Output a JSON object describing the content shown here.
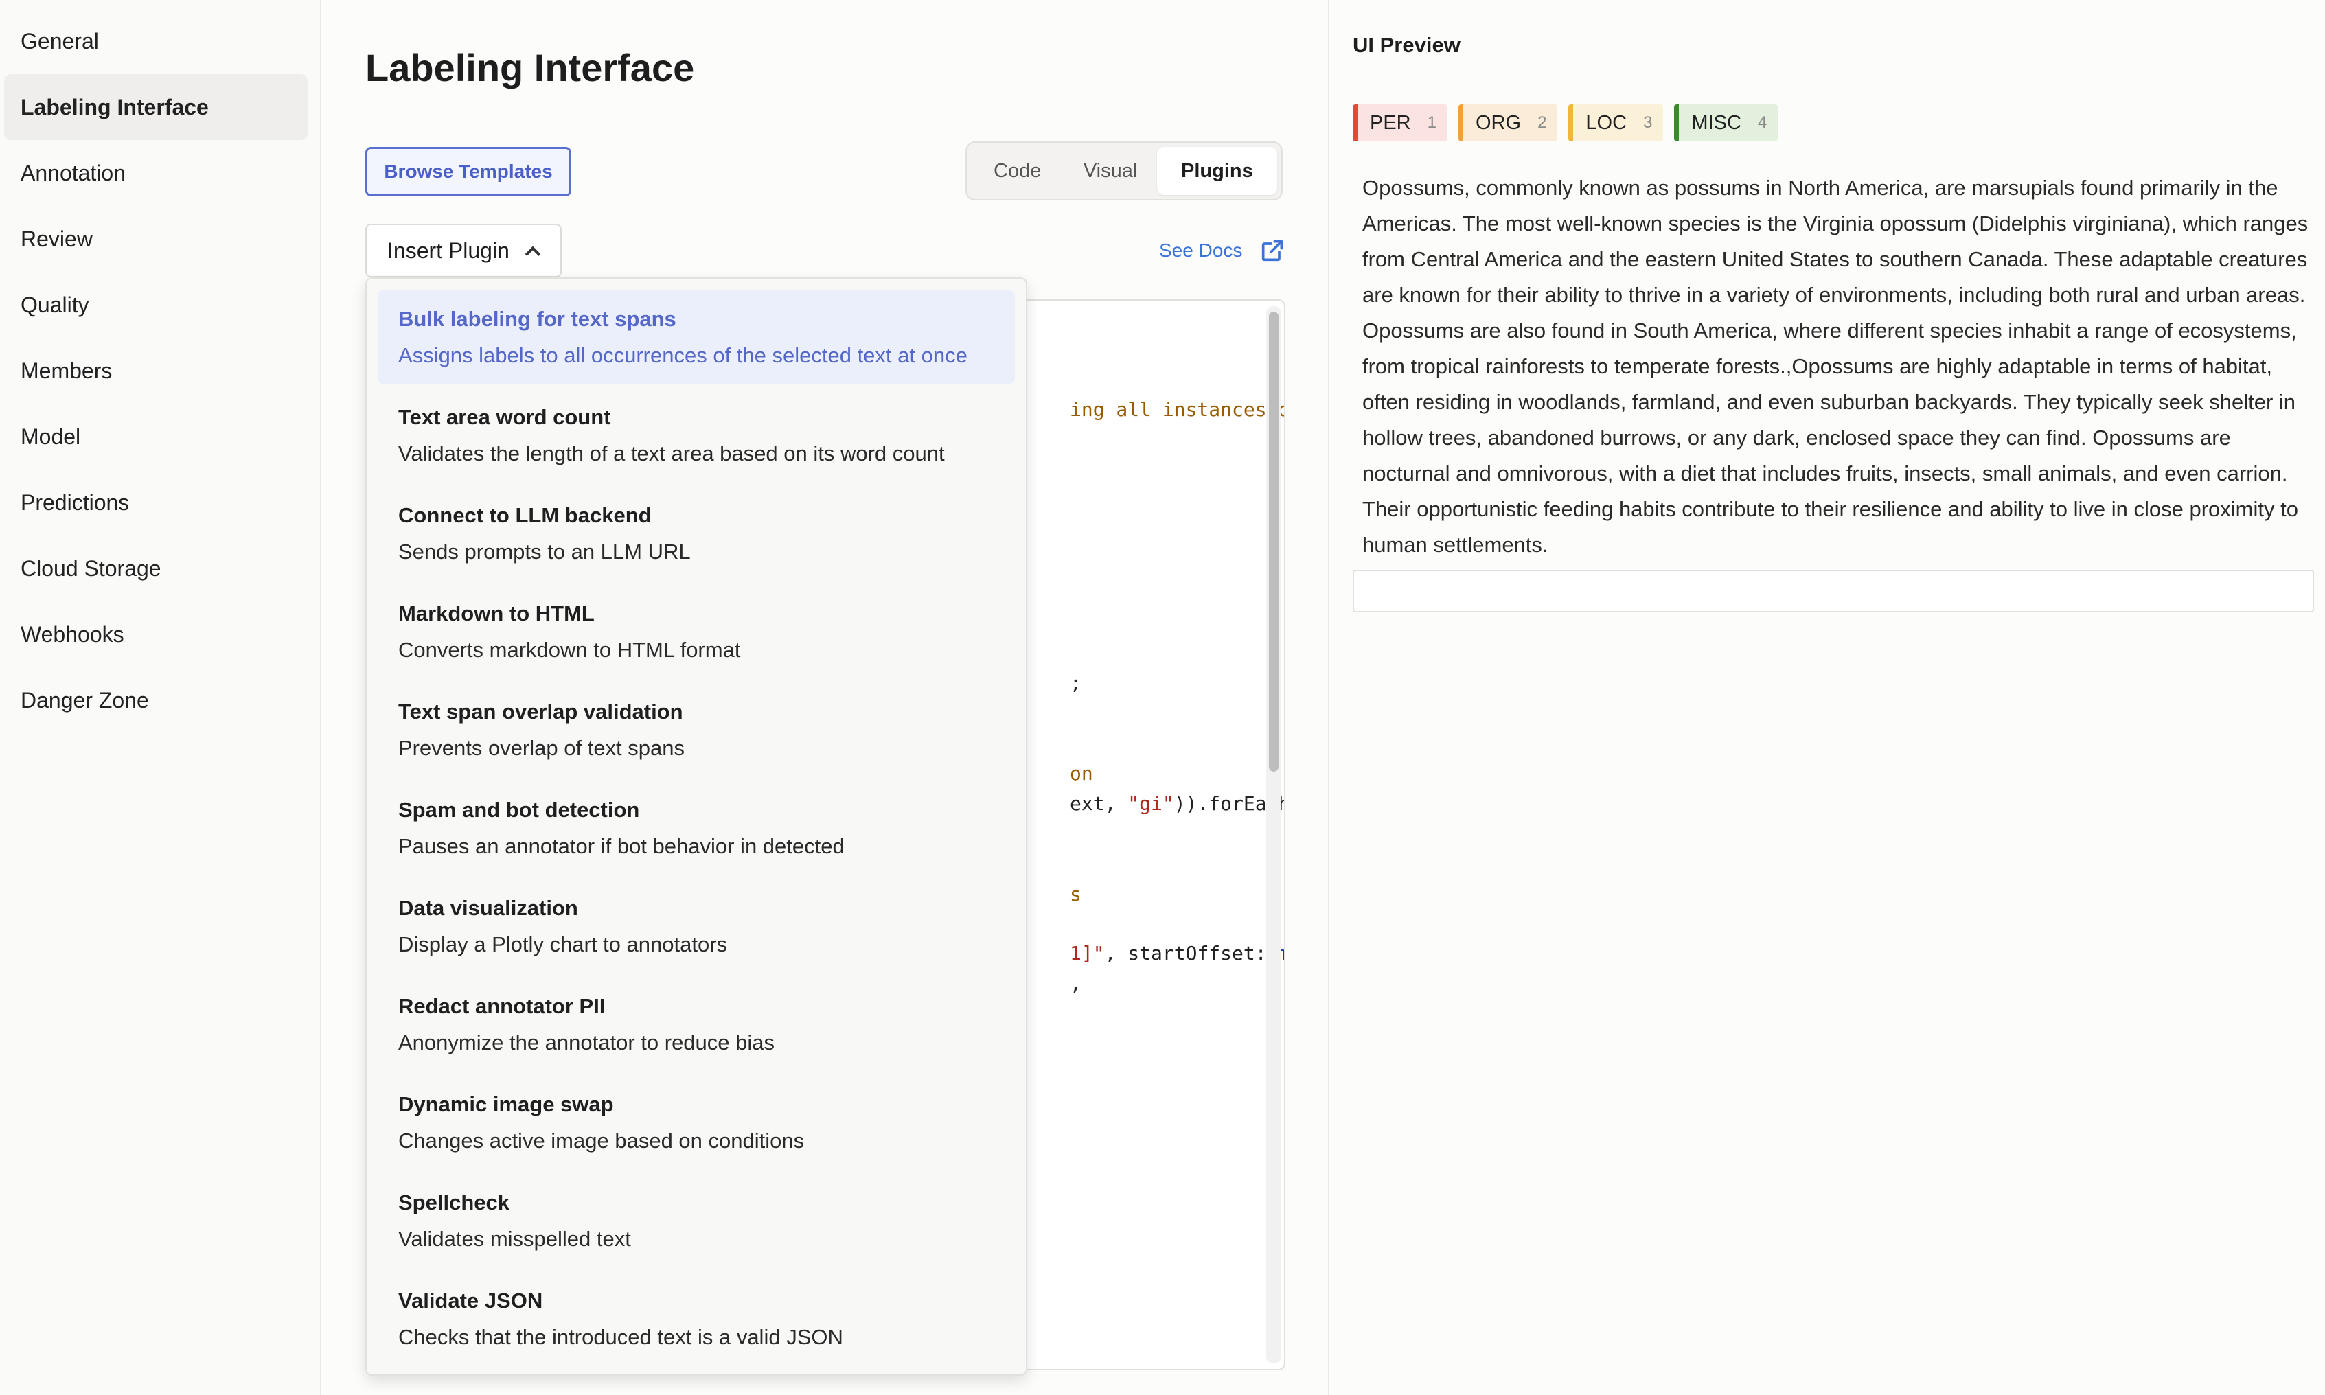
{
  "sidebar": {
    "items": [
      {
        "label": "General"
      },
      {
        "label": "Labeling Interface"
      },
      {
        "label": "Annotation"
      },
      {
        "label": "Review"
      },
      {
        "label": "Quality"
      },
      {
        "label": "Members"
      },
      {
        "label": "Model"
      },
      {
        "label": "Predictions"
      },
      {
        "label": "Cloud Storage"
      },
      {
        "label": "Webhooks"
      },
      {
        "label": "Danger Zone"
      }
    ],
    "active": "Labeling Interface"
  },
  "main": {
    "title": "Labeling Interface",
    "browse_label": "Browse Templates",
    "tabs": [
      {
        "label": "Code"
      },
      {
        "label": "Visual"
      },
      {
        "label": "Plugins"
      }
    ],
    "active_tab": "Plugins",
    "insert_label": "Insert Plugin",
    "see_docs_label": "See Docs"
  },
  "code": {
    "fragments": [
      {
        "text": "ing all instances of",
        "style": "comment"
      },
      {
        "text": ";",
        "style": "plain"
      },
      {
        "text": "on",
        "style": "comment"
      },
      {
        "text": "ext, ",
        "style": "plain",
        "str": "\"gi\"",
        "rest": ")).forEach("
      },
      {
        "text": "s",
        "style": "comment"
      },
      {
        "text": "1]\"",
        "style": "string",
        "rest": ", startOffset: ",
        "fn": "m."
      },
      {
        "text": ",",
        "style": "plain"
      }
    ]
  },
  "dropdown": {
    "items": [
      {
        "title": "Bulk labeling for text spans",
        "desc": "Assigns labels to all occurrences of the selected text at once"
      },
      {
        "title": "Text area word count",
        "desc": "Validates the length of a text area based on its word count"
      },
      {
        "title": "Connect to LLM backend",
        "desc": "Sends prompts to an LLM URL"
      },
      {
        "title": "Markdown to HTML",
        "desc": "Converts markdown to HTML format"
      },
      {
        "title": "Text span overlap validation",
        "desc": "Prevents overlap of text spans"
      },
      {
        "title": "Spam and bot detection",
        "desc": "Pauses an annotator if bot behavior in detected"
      },
      {
        "title": "Data visualization",
        "desc": "Display a Plotly chart to annotators"
      },
      {
        "title": "Redact annotator PII",
        "desc": "Anonymize the annotator to reduce bias"
      },
      {
        "title": "Dynamic image swap",
        "desc": "Changes active image based on conditions"
      },
      {
        "title": "Spellcheck",
        "desc": "Validates misspelled text"
      },
      {
        "title": "Validate JSON",
        "desc": "Checks that the introduced text is a valid JSON"
      }
    ],
    "selected": "Bulk labeling for text spans"
  },
  "preview": {
    "title": "UI Preview",
    "labels": [
      {
        "name": "PER",
        "hotkey": "1",
        "color": "#e5483a"
      },
      {
        "name": "ORG",
        "hotkey": "2",
        "color": "#f0a23a"
      },
      {
        "name": "LOC",
        "hotkey": "3",
        "color": "#f2b63a"
      },
      {
        "name": "MISC",
        "hotkey": "4",
        "color": "#3d8a2c"
      }
    ],
    "text": "Opossums, commonly known as possums in North America, are marsupials found primarily in the Americas. The most well-known species is the Virginia opossum (Didelphis virginiana), which ranges from Central America and the eastern United States to southern Canada. These adaptable creatures are known for their ability to thrive in a variety of environments, including both rural and urban areas. Opossums are also found in South America, where different species inhabit a range of ecosystems, from tropical rainforests to temperate forests.,Opossums are highly adaptable in terms of habitat, often residing in woodlands, farmland, and even suburban backyards. They typically seek shelter in hollow trees, abandoned burrows, or any dark, enclosed space they can find. Opossums are nocturnal and omnivorous, with a diet that includes fruits, insects, small animals, and even carrion. Their opportunistic feeding habits contribute to their resilience and ability to live in close proximity to human settlements."
  },
  "colors": {
    "accent": "#4a5fc7",
    "link": "#3b73d9",
    "selected_bg": "#ebeefb"
  }
}
